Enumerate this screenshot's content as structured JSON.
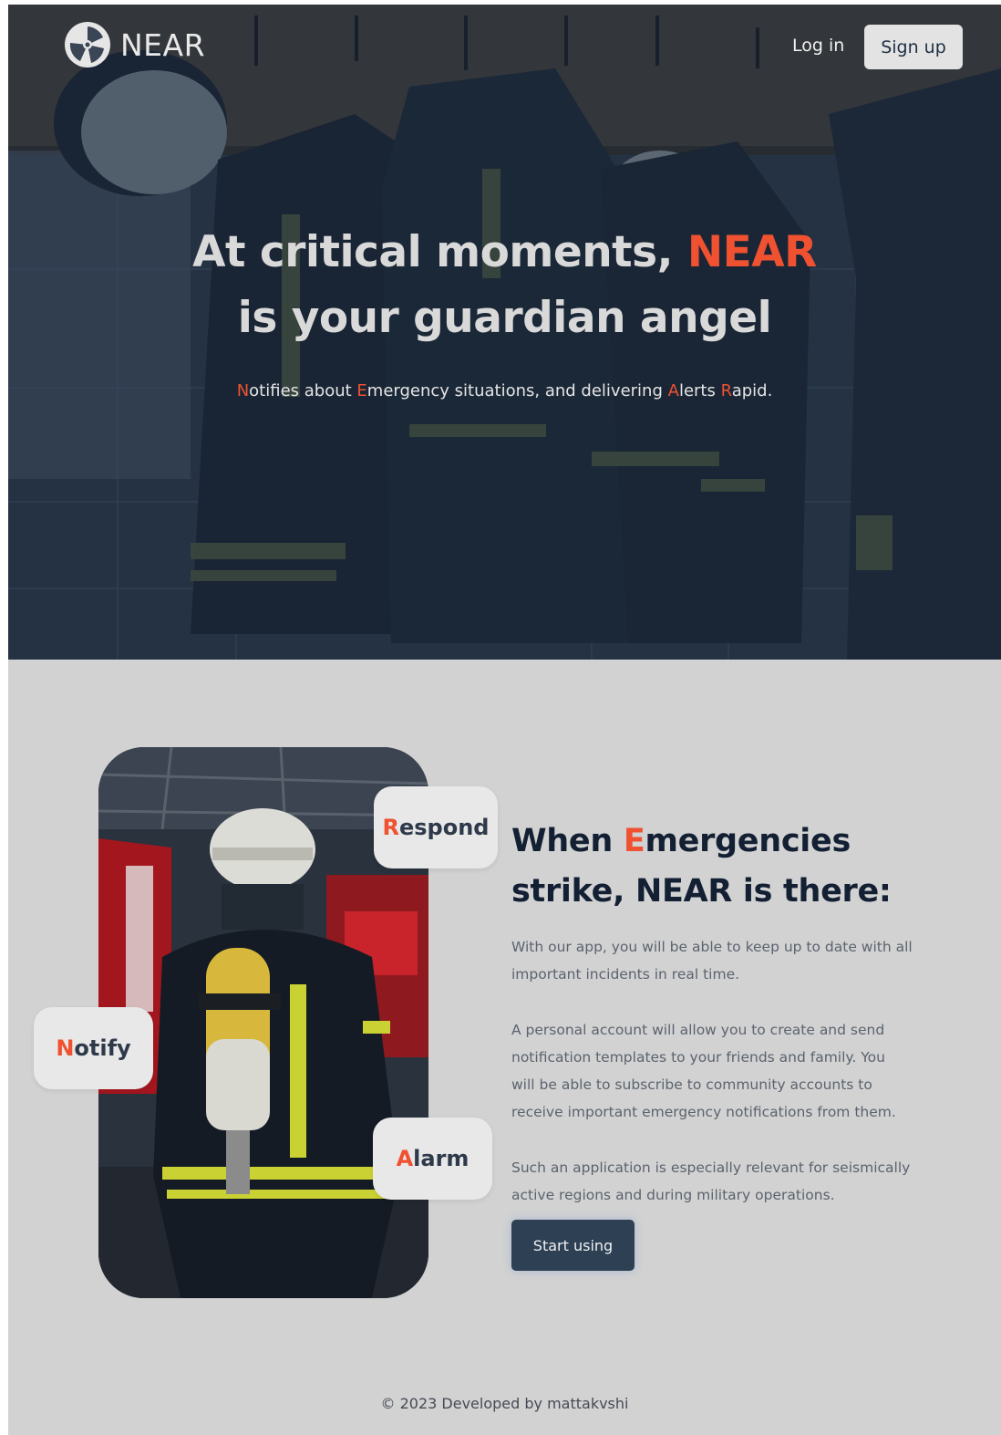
{
  "nav": {
    "brand": "NEAR",
    "login_label": "Log in",
    "signup_label": "Sign up"
  },
  "hero": {
    "title_part1": "At critical moments, ",
    "title_accent": "NEAR",
    "title_part2": "is your guardian angel",
    "subtitle": [
      {
        "initial": "N",
        "rest": "otifies about "
      },
      {
        "initial": "E",
        "rest": "mergency situations, and delivering "
      },
      {
        "initial": "A",
        "rest": "lerts "
      },
      {
        "initial": "R",
        "rest": "apid."
      }
    ]
  },
  "badges": {
    "respond": {
      "initial": "R",
      "rest": "espond"
    },
    "notify": {
      "initial": "N",
      "rest": "otify"
    },
    "alarm": {
      "initial": "A",
      "rest": "larm"
    }
  },
  "feature": {
    "title_part1": "When ",
    "title_accent": "E",
    "title_part2": "mergencies strike, NEAR is there:",
    "paragraphs": [
      "With our app, you will be able to keep up to date with all important incidents in real time.",
      "A personal account will allow you to create and send notification templates to your friends and family. You will be able to subscribe to community accounts to receive important emergency notifications from them.",
      "Such an application is especially relevant for seismically active regions and during military operations."
    ],
    "cta_label": "Start using"
  },
  "footer": {
    "text": "© 2023 Developed by mattakvshi"
  },
  "colors": {
    "accent": "#ef5131",
    "page_bg": "#d2d2d2",
    "heading": "#132033",
    "button_bg": "#2e4053"
  },
  "icons": {
    "logo": "aperture-logo-icon"
  }
}
